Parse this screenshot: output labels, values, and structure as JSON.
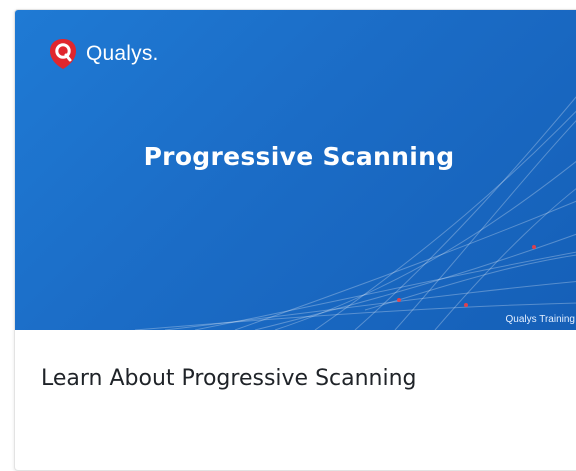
{
  "card": {
    "thumbnail": {
      "logo_text": "Qualys.",
      "video_title": "Progressive Scanning",
      "watermark": "Qualys Training",
      "logo_icon": "qualys-shield-icon",
      "background_color": "#1b6cc6",
      "logo_color": "#e0262d"
    },
    "title": "Learn About Progressive Scanning"
  }
}
